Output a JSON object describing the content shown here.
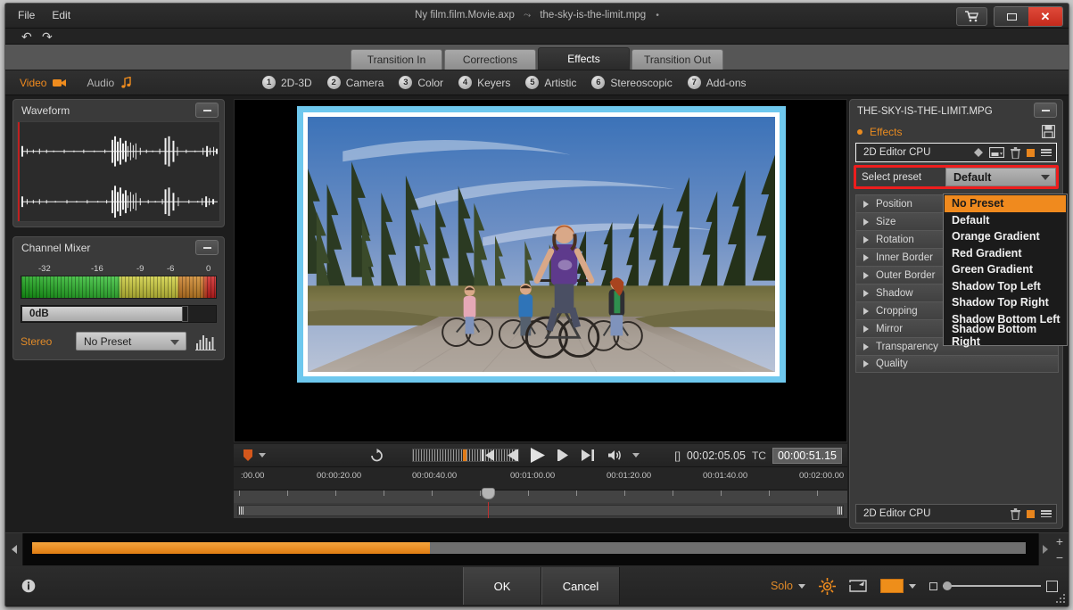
{
  "titlebar": {
    "menu": [
      "File",
      "Edit"
    ],
    "project": "Ny film.film.Movie.axp",
    "separator": "⤳",
    "clip": "the-sky-is-the-limit.mpg",
    "modified": "•",
    "cart_icon": "shopping-cart-icon",
    "restore_icon": "restore-window-icon",
    "close_icon": "close-window-icon"
  },
  "undobar": {
    "undo_icon": "undo-arrow-icon",
    "redo_icon": "redo-arrow-icon"
  },
  "tabs": [
    {
      "label": "Transition In",
      "active": false
    },
    {
      "label": "Corrections",
      "active": false
    },
    {
      "label": "Effects",
      "active": true
    },
    {
      "label": "Transition Out",
      "active": false
    }
  ],
  "mode_toggle": {
    "video_label": "Video",
    "video_icon": "video-camera-icon",
    "audio_label": "Audio",
    "audio_icon": "music-note-icon"
  },
  "categories": [
    {
      "num": "1",
      "label": "2D-3D"
    },
    {
      "num": "2",
      "label": "Camera"
    },
    {
      "num": "3",
      "label": "Color"
    },
    {
      "num": "4",
      "label": "Keyers"
    },
    {
      "num": "5",
      "label": "Artistic"
    },
    {
      "num": "6",
      "label": "Stereoscopic"
    },
    {
      "num": "7",
      "label": "Add-ons"
    }
  ],
  "waveform_panel": {
    "title": "Waveform",
    "minimize_icon": "minimize-icon"
  },
  "channel_mixer": {
    "title": "Channel Mixer",
    "minimize_icon": "minimize-icon",
    "scale": [
      "-32",
      "-16",
      "-9",
      "-6",
      "0"
    ],
    "gain_value": "0dB",
    "channel_label": "Stereo",
    "preset_value": "No Preset",
    "eq_icon": "equalizer-icon"
  },
  "transport": {
    "marker_icon": "marker-flag-icon",
    "loop_icon": "loop-icon",
    "skip_back_icon": "skip-to-start-icon",
    "step_back_icon": "step-backward-icon",
    "play_icon": "play-icon",
    "step_fwd_icon": "step-forward-icon",
    "skip_fwd_icon": "skip-to-end-icon",
    "volume_icon": "volume-icon",
    "duration_bracket": "[]",
    "duration": "00:02:05.05",
    "tc_label": "TC",
    "tc_value": "00:00:51.15"
  },
  "ruler": {
    "labels": [
      ":00.00",
      "00:00:20.00",
      "00:00:40.00",
      "00:01:00.00",
      "00:01:20.00",
      "00:01:40.00",
      "00:02:00.00"
    ]
  },
  "right_panel": {
    "title": "THE-SKY-IS-THE-LIMIT.MPG",
    "minimize_icon": "minimize-icon",
    "section_label": "Effects",
    "save_icon": "save-disk-icon",
    "effect_name": "2D Editor CPU",
    "effect_icons": [
      "keyframe-diamond-icon",
      "preset-list-icon",
      "trash-icon",
      "enable-square-icon",
      "menu-icon"
    ],
    "preset_label": "Select preset",
    "preset_value": "Default",
    "preset_options": [
      "No Preset",
      "Default",
      "Orange Gradient",
      "Red Gradient",
      "Green Gradient",
      "Shadow Top Left",
      "Shadow Top Right",
      "Shadow Bottom Left",
      "Shadow Bottom Right"
    ],
    "preset_selected": "No Preset",
    "properties": [
      "Position",
      "Size",
      "Rotation",
      "Inner Border",
      "Outer Border",
      "Shadow",
      "Cropping",
      "Mirror",
      "Transparency",
      "Quality"
    ],
    "footer_name": "2D Editor CPU",
    "footer_icons": [
      "trash-icon",
      "enable-square-icon",
      "menu-icon"
    ],
    "highlight_color": "#ee1d1d"
  },
  "bottombar": {
    "info_icon": "info-icon",
    "ok_label": "OK",
    "cancel_label": "Cancel",
    "solo_label": "Solo",
    "settings_icon": "settings-star-icon",
    "fullscreen_icon": "expand-window-icon",
    "color_swatch": "#ee8e1a",
    "zoom_small_icon": "zoom-small-icon",
    "zoom_large_icon": "zoom-large-icon",
    "resize_grip_icon": "resize-grip-icon"
  },
  "colors": {
    "accent": "#f08a1e",
    "highlight_red": "#ee1d1d",
    "panel_bg": "#3a3a3a",
    "app_bg": "#1d1d1d"
  }
}
